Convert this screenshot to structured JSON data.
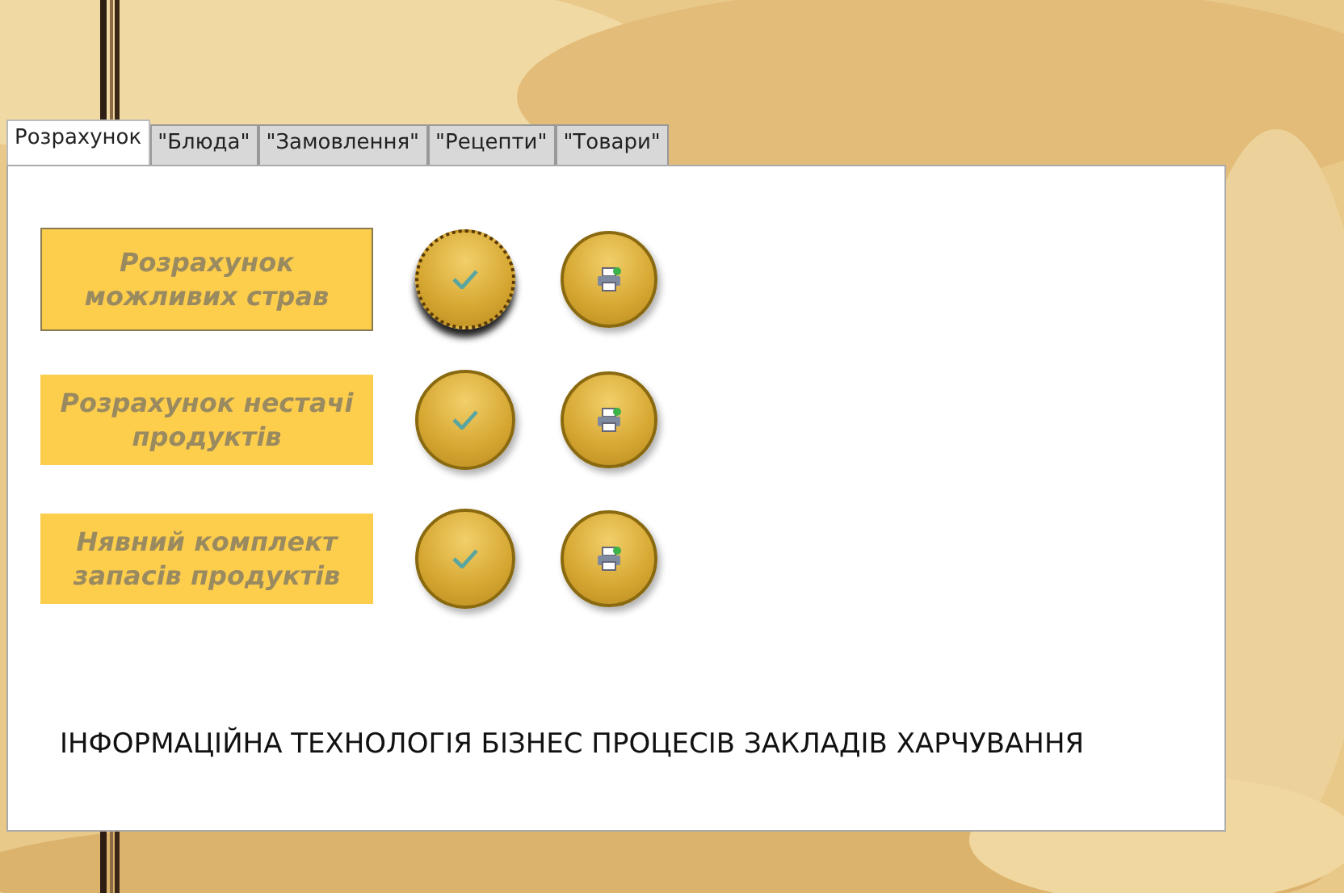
{
  "tabs": [
    {
      "label": "Розрахунок",
      "selected": true
    },
    {
      "label": "\"Блюда\"",
      "selected": false
    },
    {
      "label": "\"Замовлення\"",
      "selected": false
    },
    {
      "label": "\"Рецепти\"",
      "selected": false
    },
    {
      "label": "\"Товари\"",
      "selected": false
    }
  ],
  "rows": [
    {
      "label": "Розрахунок можливих страв",
      "focused": true
    },
    {
      "label": "Розрахунок нестачі продуктів",
      "focused": false
    },
    {
      "label": "Нявний комплект запасів продуктів",
      "focused": false
    }
  ],
  "footer": "ІНФОРМАЦІЙНА ТЕХНОЛОГІЯ БІЗНЕС ПРОЦЕСІВ ЗАКЛАДІВ ХАРЧУВАННЯ"
}
